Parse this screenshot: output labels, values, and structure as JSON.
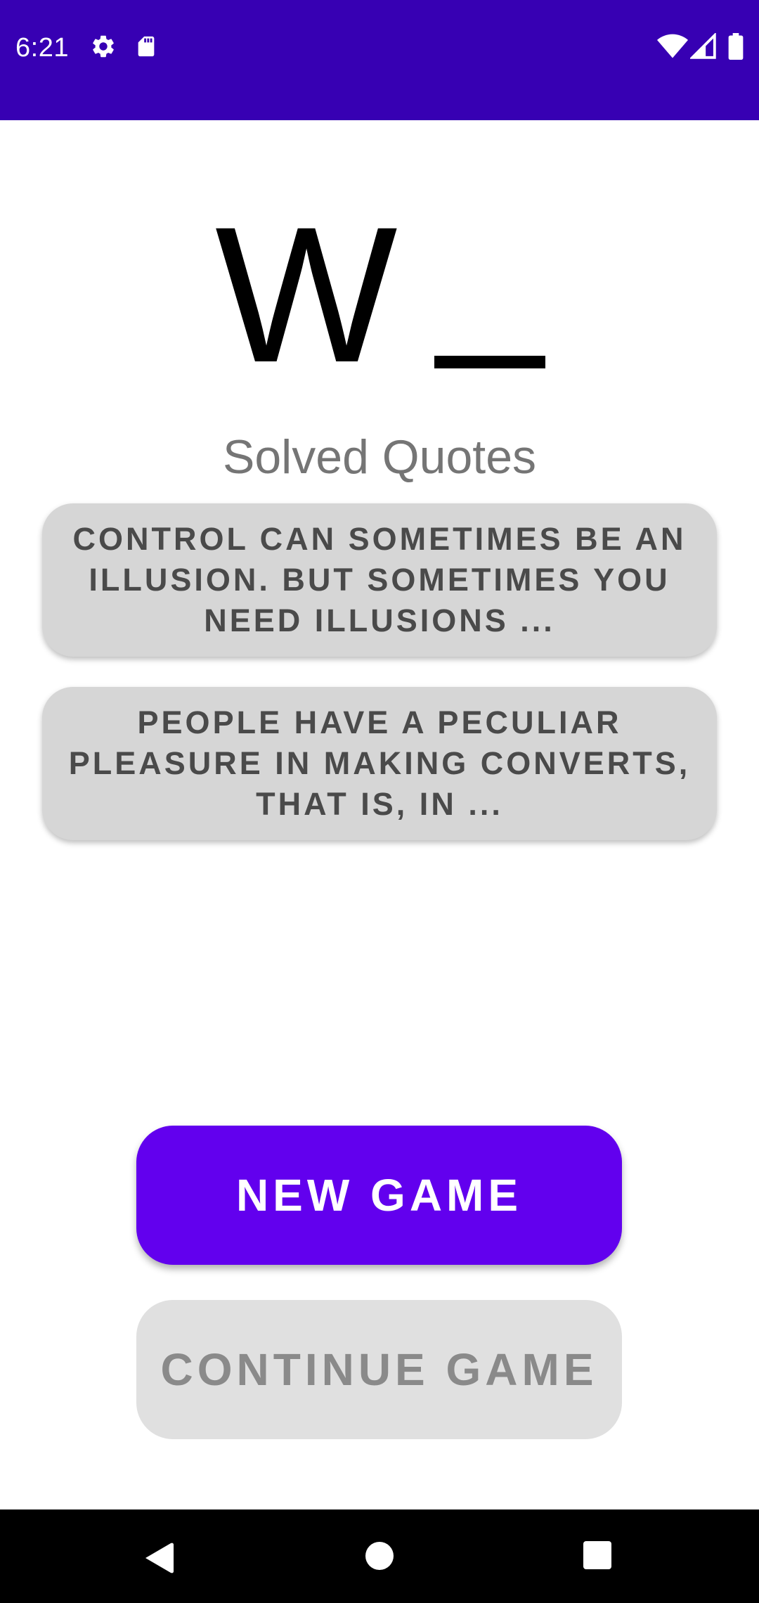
{
  "status_bar": {
    "time": "6:21",
    "background": "#3700b3",
    "icons": [
      "settings-icon",
      "sd-card-icon",
      "wifi-icon",
      "signal-icon",
      "battery-icon"
    ]
  },
  "logo": {
    "letter": "W",
    "suffix": "_"
  },
  "section_title": "Solved Quotes",
  "quotes": [
    {
      "text": "CONTROL CAN SOMETIMES BE AN ILLUSION. BUT SOMETIMES YOU NEED ILLUSIONS ..."
    },
    {
      "text": "PEOPLE HAVE A PECULIAR PLEASURE IN MAKING CONVERTS, THAT IS, IN ..."
    }
  ],
  "buttons": {
    "new_game": "NEW GAME",
    "continue_game": "CONTINUE GAME"
  },
  "colors": {
    "primary": "#6200ee",
    "primary_dark": "#3700b3",
    "card": "#d6d6d6",
    "disabled": "#e0e0e0"
  },
  "nav_bar": {
    "icons": [
      "back-icon",
      "home-icon",
      "recents-icon"
    ]
  }
}
